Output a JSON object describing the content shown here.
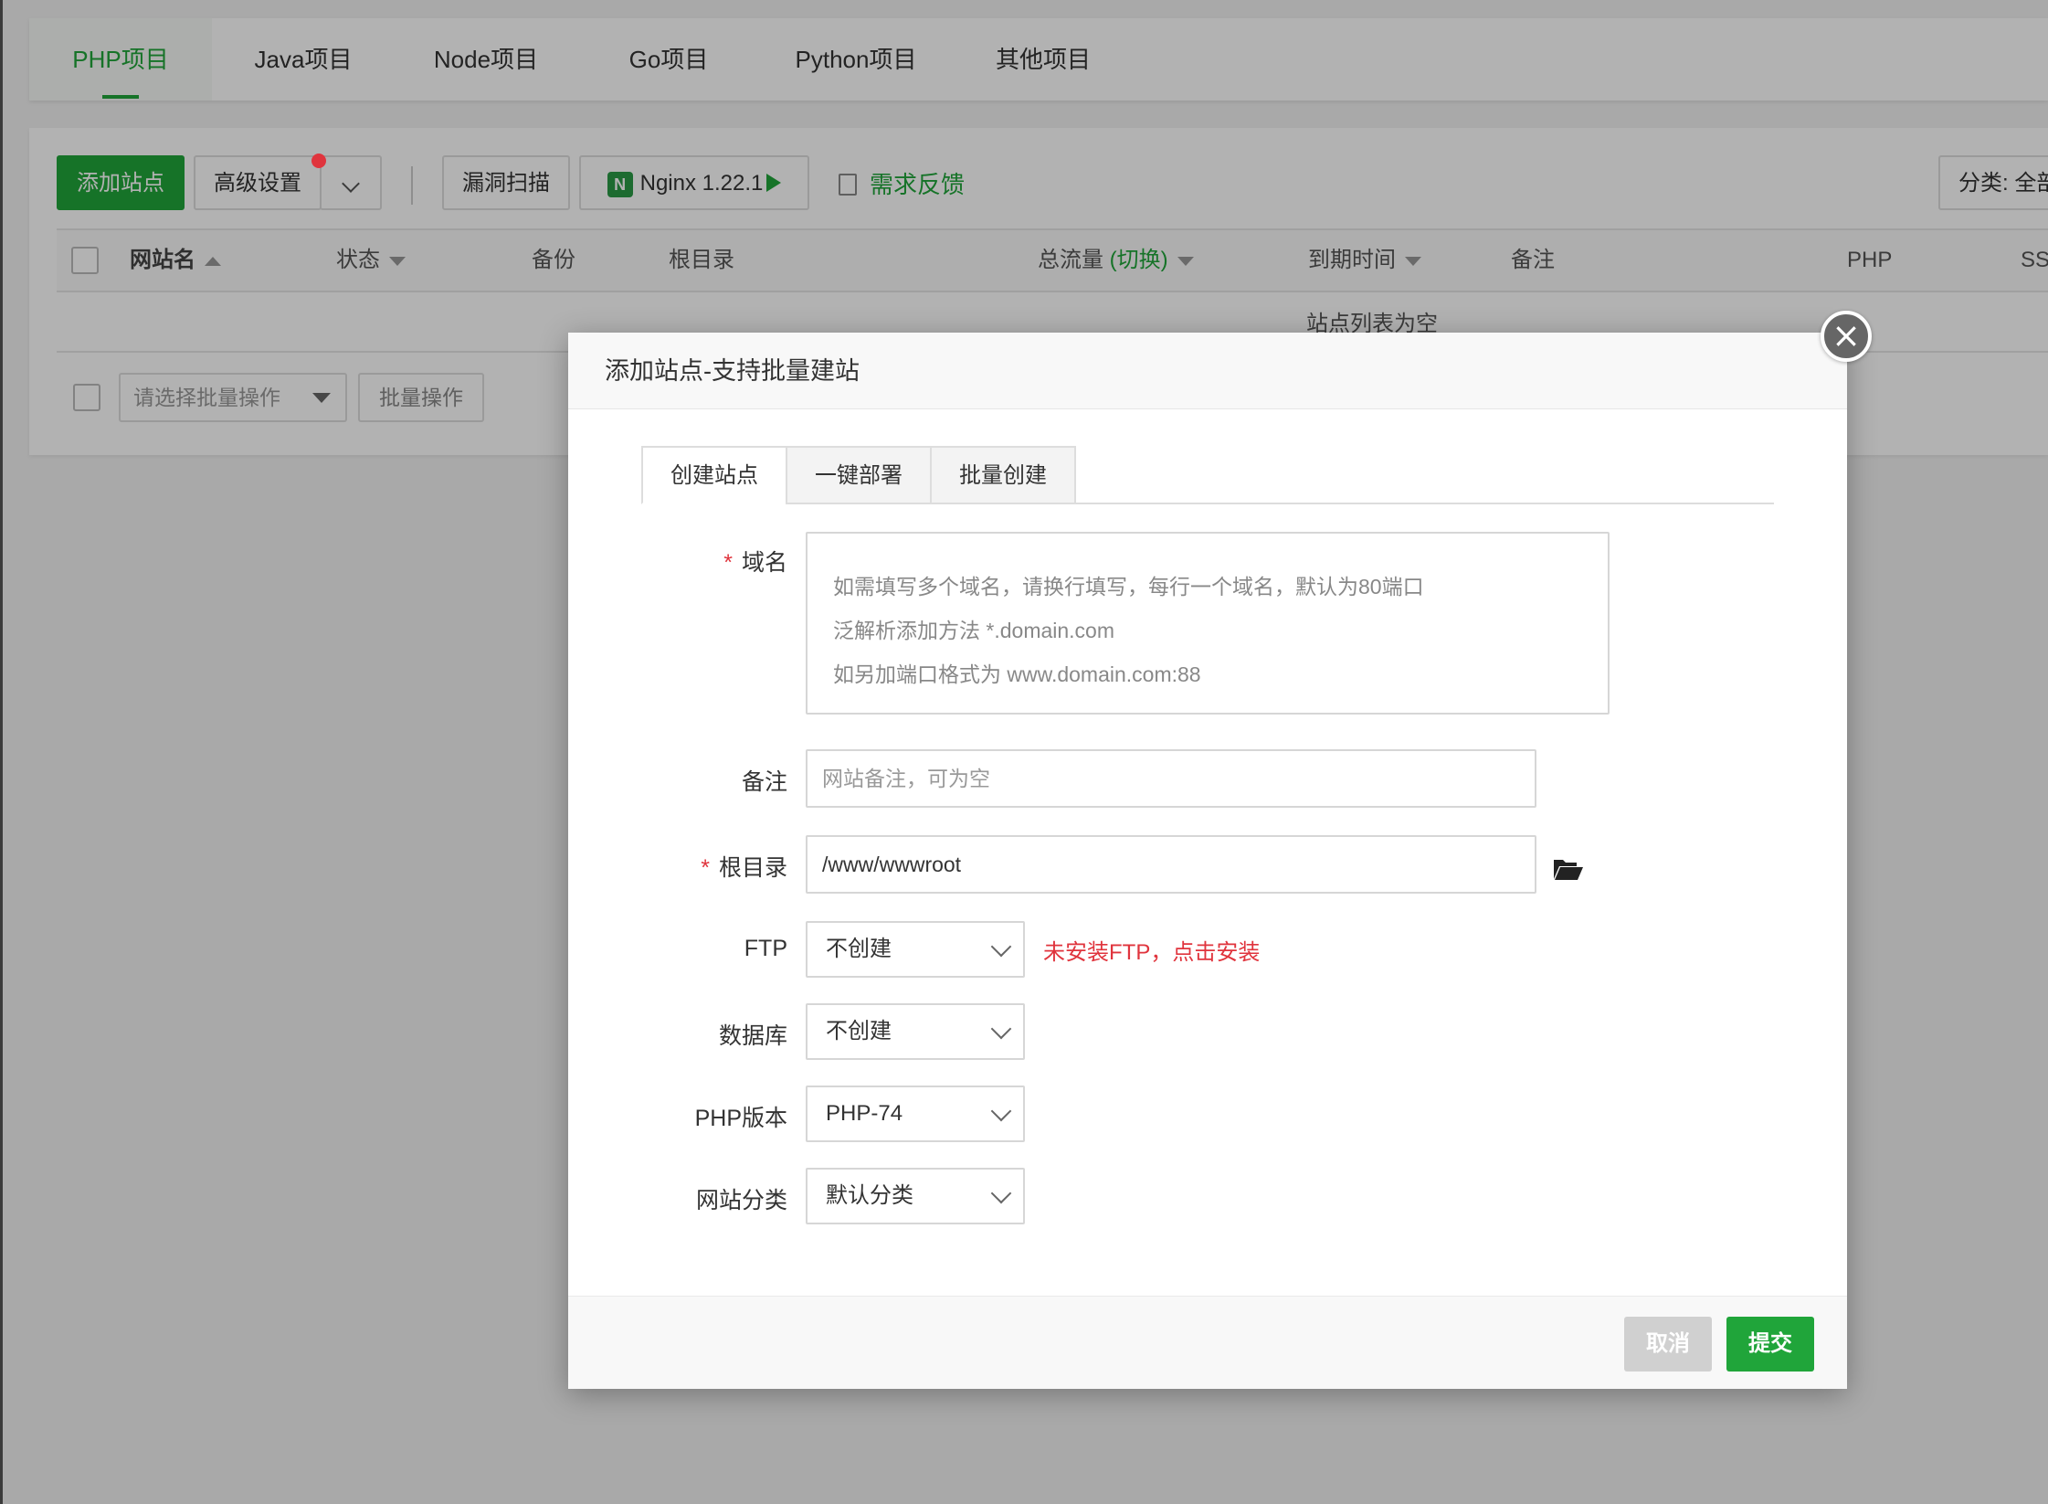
{
  "project_tabs": [
    "PHP项目",
    "Java项目",
    "Node项目",
    "Go项目",
    "Python项目",
    "其他项目"
  ],
  "toolbar": {
    "add_site": "添加站点",
    "advanced": "高级设置",
    "vuln_scan": "漏洞扫描",
    "nginx": "Nginx 1.22.1",
    "nginx_badge": "N",
    "feedback": "需求反馈",
    "category": "分类: 全部"
  },
  "table": {
    "headers": {
      "site_name": "网站名",
      "status": "状态",
      "backup": "备份",
      "root": "根目录",
      "traffic": "总流量",
      "traffic_switch": "(切换)",
      "expire": "到期时间",
      "remark": "备注",
      "php": "PHP",
      "ssl": "SSL"
    },
    "empty": "站点列表为空"
  },
  "batch": {
    "placeholder": "请选择批量操作",
    "button": "批量操作"
  },
  "modal": {
    "title": "添加站点-支持批量建站",
    "close": "×",
    "tabs": [
      "创建站点",
      "一键部署",
      "批量创建"
    ],
    "fields": {
      "domain_label": "域名",
      "domain_placeholder": [
        "如需填写多个域名，请换行填写，每行一个域名，默认为80端口",
        "泛解析添加方法 *.domain.com",
        "如另加端口格式为 www.domain.com:88"
      ],
      "remark_label": "备注",
      "remark_placeholder": "网站备注，可为空",
      "root_label": "根目录",
      "root_value": "/www/wwwroot",
      "ftp_label": "FTP",
      "ftp_value": "不创建",
      "ftp_warning": "未安装FTP，点击安装",
      "db_label": "数据库",
      "db_value": "不创建",
      "php_label": "PHP版本",
      "php_value": "PHP-74",
      "category_label": "网站分类",
      "category_value": "默认分类",
      "required_mark": "*"
    },
    "footer": {
      "cancel": "取消",
      "submit": "提交"
    }
  },
  "colors": {
    "accent": "#20a53a",
    "danger": "#e0343d"
  },
  "icons": [
    "play-icon",
    "nginx-icon",
    "edit-icon",
    "sort-up-icon",
    "sort-down-icon",
    "folder-open-icon",
    "close-icon",
    "chevron-down-icon"
  ]
}
